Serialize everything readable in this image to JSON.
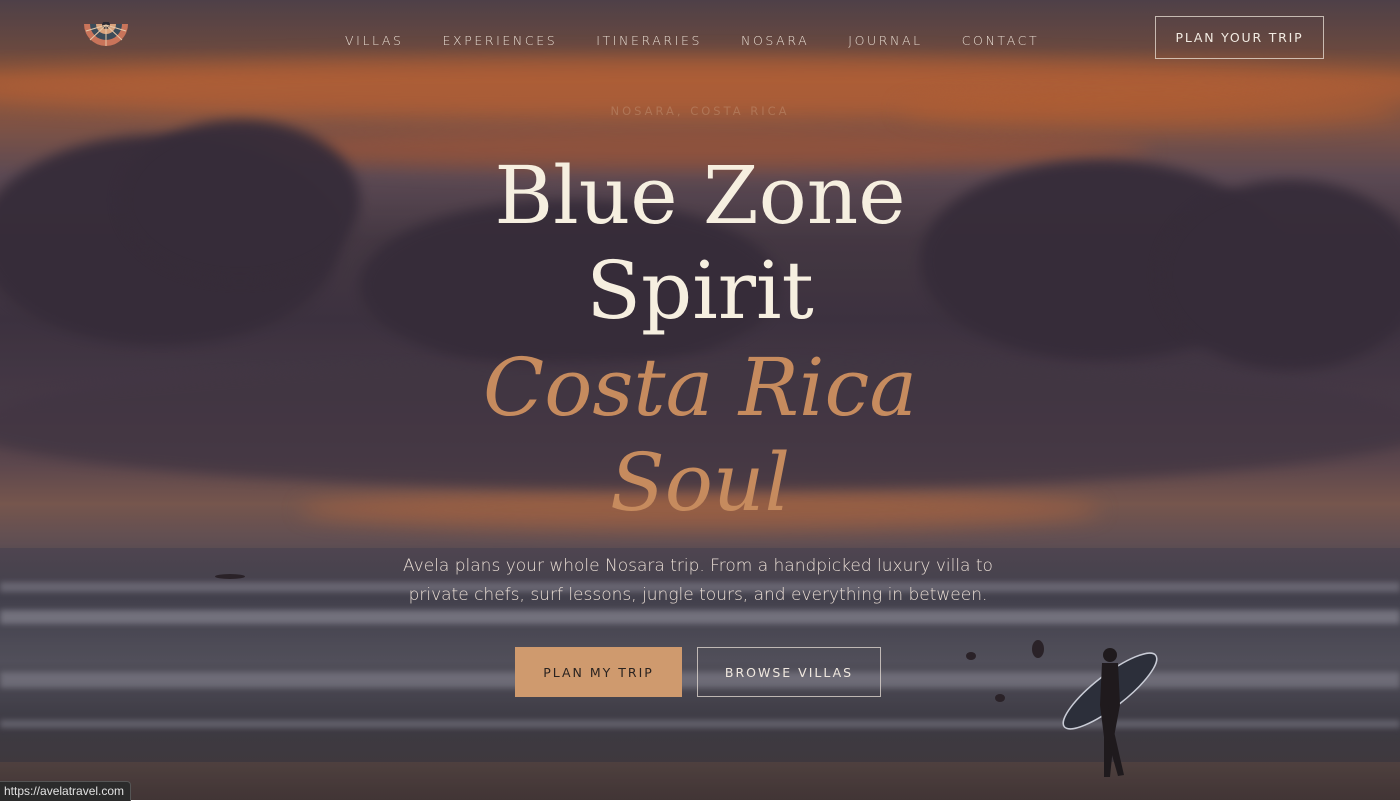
{
  "nav": {
    "items": [
      "VILLAS",
      "EXPERIENCES",
      "ITINERARIES",
      "NOSARA",
      "JOURNAL",
      "CONTACT"
    ],
    "cta_label": "PLAN YOUR TRIP"
  },
  "hero": {
    "eyebrow": "NOSARA, COSTA RICA",
    "title_line1": "Blue Zone",
    "title_line2": "Spirit",
    "title_line3": "Costa Rica",
    "title_line4": "Soul",
    "lede": "Avela plans your whole Nosara trip. From a handpicked luxury villa to private chefs, surf lessons, jungle tours, and everything in between.",
    "primary_cta": "PLAN MY TRIP",
    "secondary_cta": "BROWSE VILLAS"
  },
  "status_bar": {
    "url": "https://avelatravel.com"
  },
  "icons": {
    "logo": "sun-mandala-logo-icon"
  },
  "colors": {
    "accent": "#cf9a6e",
    "title_cream": "#f6efe0",
    "title_italic": "#c68b5e"
  }
}
